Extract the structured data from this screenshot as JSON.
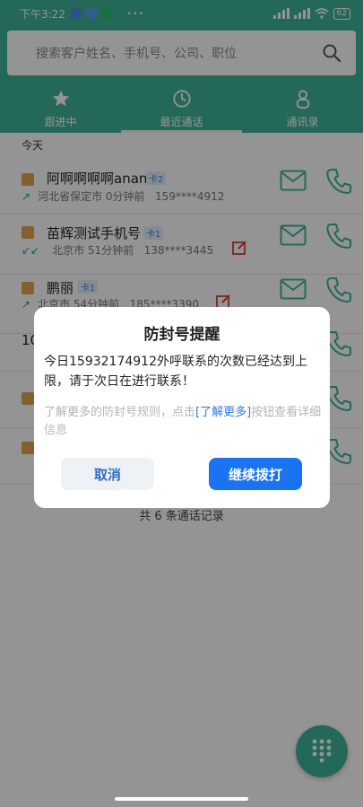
{
  "status_bar": {
    "time": "下午3:22",
    "battery": "62"
  },
  "search": {
    "placeholder": "搜索客户姓名、手机号、公司、职位"
  },
  "tabs": [
    {
      "label": "跟进中"
    },
    {
      "label": "最近通话"
    },
    {
      "label": "通讯录"
    }
  ],
  "section": {
    "today": "今天"
  },
  "calls": [
    {
      "name": "阿啊啊啊啊anan",
      "tag": "卡2",
      "location": "河北省保定市 0分钟前",
      "phone": "159****4912"
    },
    {
      "name": "苗辉测试手机号",
      "tag": "卡1",
      "location": "北京市 51分钟前",
      "phone": "138****3445"
    },
    {
      "name": "鹏丽",
      "tag": "卡1",
      "location": "北京市 54分钟前",
      "phone": "185****3390"
    }
  ],
  "partial": {
    "leading_text": "10"
  },
  "footer": {
    "count_text": "共 6 条通话记录"
  },
  "dialog": {
    "title": "防封号提醒",
    "message": "今日15932174912外呼联系的次数已经达到上限，请于次日在进行联系！",
    "hint_prefix": "了解更多的防封号规则，点击",
    "hint_link": "[了解更多]",
    "hint_suffix": "按钮查看详细信息",
    "cancel_label": "取消",
    "confirm_label": "继续拨打"
  },
  "colors": {
    "brand": "#3fb39b",
    "primary_button": "#1a73f0",
    "link": "#2f7ae5"
  }
}
